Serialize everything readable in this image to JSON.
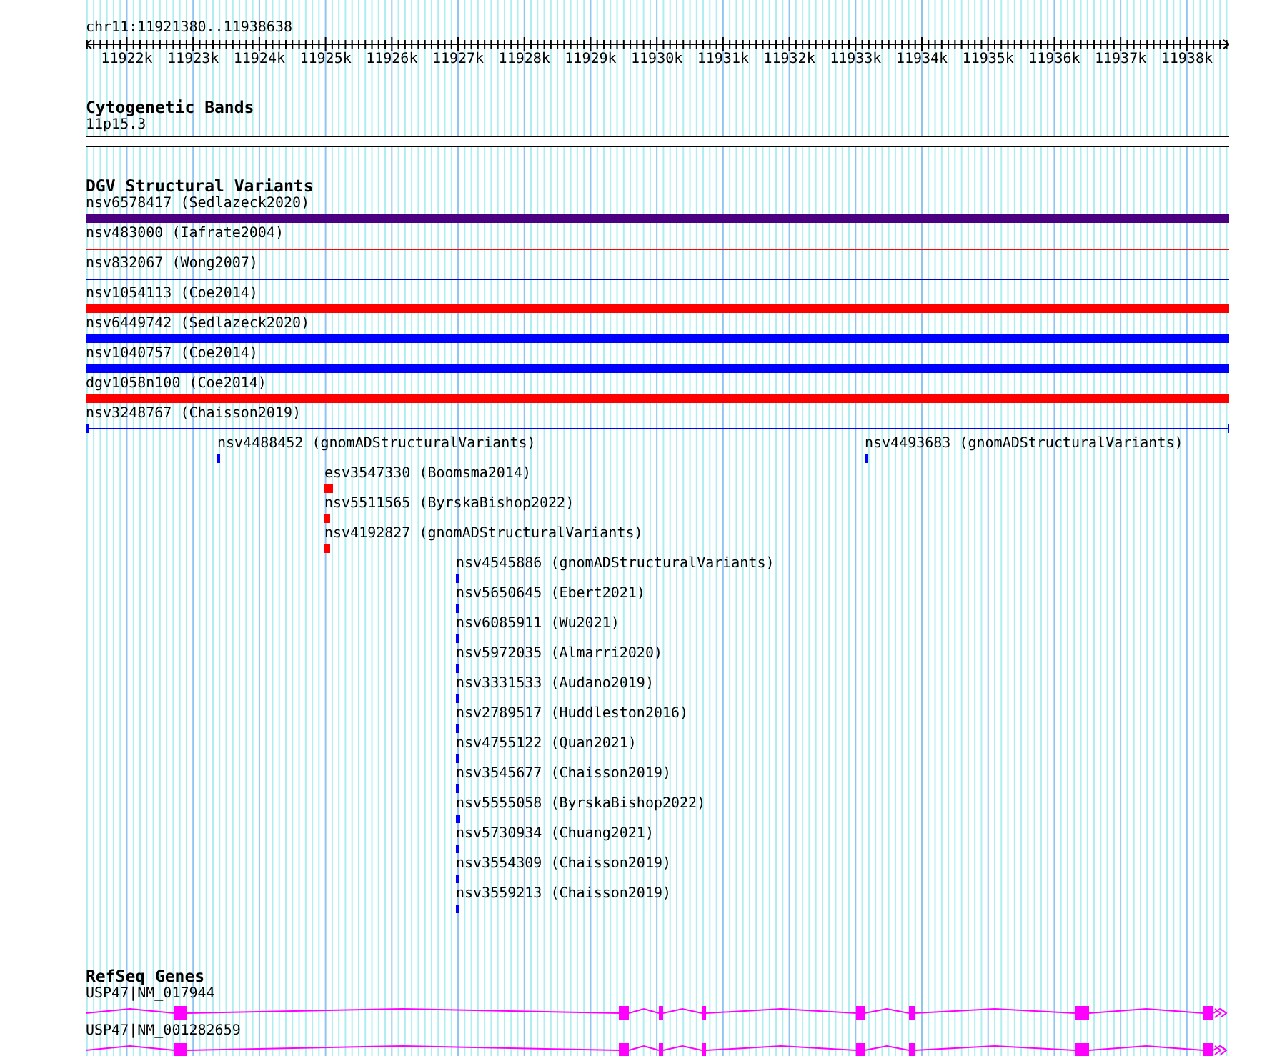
{
  "location": "chr11:11921380..11938638",
  "ruler": {
    "labels": [
      "11922k",
      "11923k",
      "11924k",
      "11925k",
      "11926k",
      "11927k",
      "11928k",
      "11929k",
      "11930k",
      "11931k",
      "11932k",
      "11933k",
      "11934k",
      "11935k",
      "11936k",
      "11937k",
      "11938k"
    ]
  },
  "cytogenetic_bands": {
    "title": "Cytogenetic Bands",
    "band": "11p15.3"
  },
  "dgv_structural_variants": {
    "title": "DGV Structural Variants",
    "rows": [
      {
        "features": [
          {
            "label": "nsv6578417 (Sedlazeck2020)",
            "kind": "thick",
            "color": "#4b0082"
          }
        ]
      },
      {
        "features": [
          {
            "label": "nsv483000 (Iafrate2004)",
            "kind": "thin",
            "color": "#ff0000"
          }
        ]
      },
      {
        "features": [
          {
            "label": "nsv832067 (Wong2007)",
            "kind": "thin",
            "color": "#0000cc"
          }
        ]
      },
      {
        "features": [
          {
            "label": "nsv1054113 (Coe2014)",
            "kind": "thick",
            "color": "#ff0000"
          }
        ]
      },
      {
        "features": [
          {
            "label": "nsv6449742 (Sedlazeck2020)",
            "kind": "thick",
            "color": "#0000ff"
          }
        ]
      },
      {
        "features": [
          {
            "label": "nsv1040757 (Coe2014)",
            "kind": "thick",
            "color": "#0000ff"
          }
        ]
      },
      {
        "features": [
          {
            "label": "dgv1058n100 (Coe2014)",
            "kind": "thick",
            "color": "#ff0000"
          }
        ]
      },
      {
        "features": [
          {
            "label": "nsv3248767 (Chaisson2019)",
            "kind": "span",
            "color": "#0000ff"
          }
        ]
      },
      {
        "features": [
          {
            "label": "nsv4488452 (gnomADStructuralVariants)",
            "kind": "mark",
            "color": "#0000ff"
          },
          {
            "label": "nsv4493683 (gnomADStructuralVariants)",
            "kind": "mark",
            "color": "#0000ff"
          }
        ]
      },
      {
        "features": [
          {
            "label": "esv3547330 (Boomsma2014)",
            "kind": "mark",
            "color": "#ff0000"
          }
        ]
      },
      {
        "features": [
          {
            "label": "nsv5511565 (ByrskaBishop2022)",
            "kind": "mark",
            "color": "#ff0000"
          }
        ]
      },
      {
        "features": [
          {
            "label": "nsv4192827 (gnomADStructuralVariants)",
            "kind": "mark",
            "color": "#ff0000"
          }
        ]
      },
      {
        "features": [
          {
            "label": "nsv4545886 (gnomADStructuralVariants)",
            "kind": "mark",
            "color": "#0000ff"
          }
        ]
      },
      {
        "features": [
          {
            "label": "nsv5650645 (Ebert2021)",
            "kind": "mark",
            "color": "#0000ff"
          }
        ]
      },
      {
        "features": [
          {
            "label": "nsv6085911 (Wu2021)",
            "kind": "mark",
            "color": "#0000ff"
          }
        ]
      },
      {
        "features": [
          {
            "label": "nsv5972035 (Almarri2020)",
            "kind": "mark",
            "color": "#0000ff"
          }
        ]
      },
      {
        "features": [
          {
            "label": "nsv3331533 (Audano2019)",
            "kind": "mark",
            "color": "#0000ff"
          }
        ]
      },
      {
        "features": [
          {
            "label": "nsv2789517 (Huddleston2016)",
            "kind": "mark",
            "color": "#0000ff"
          }
        ]
      },
      {
        "features": [
          {
            "label": "nsv4755122 (Quan2021)",
            "kind": "mark",
            "color": "#0000ff"
          }
        ]
      },
      {
        "features": [
          {
            "label": "nsv3545677 (Chaisson2019)",
            "kind": "mark",
            "color": "#0000ff"
          }
        ]
      },
      {
        "features": [
          {
            "label": "nsv5555058 (ByrskaBishop2022)",
            "kind": "mark",
            "color": "#0000ff"
          }
        ]
      },
      {
        "features": [
          {
            "label": "nsv5730934 (Chuang2021)",
            "kind": "mark",
            "color": "#0000ff"
          }
        ]
      },
      {
        "features": [
          {
            "label": "nsv3554309 (Chaisson2019)",
            "kind": "mark",
            "color": "#0000ff"
          }
        ]
      },
      {
        "features": [
          {
            "label": "nsv3559213 (Chaisson2019)",
            "kind": "mark",
            "color": "#0000ff"
          }
        ]
      }
    ]
  },
  "refseq_genes": {
    "title": "RefSeq Genes",
    "genes": [
      {
        "label": "USP47|NM_017944"
      },
      {
        "label": "USP47|NM_001282659"
      }
    ]
  }
}
